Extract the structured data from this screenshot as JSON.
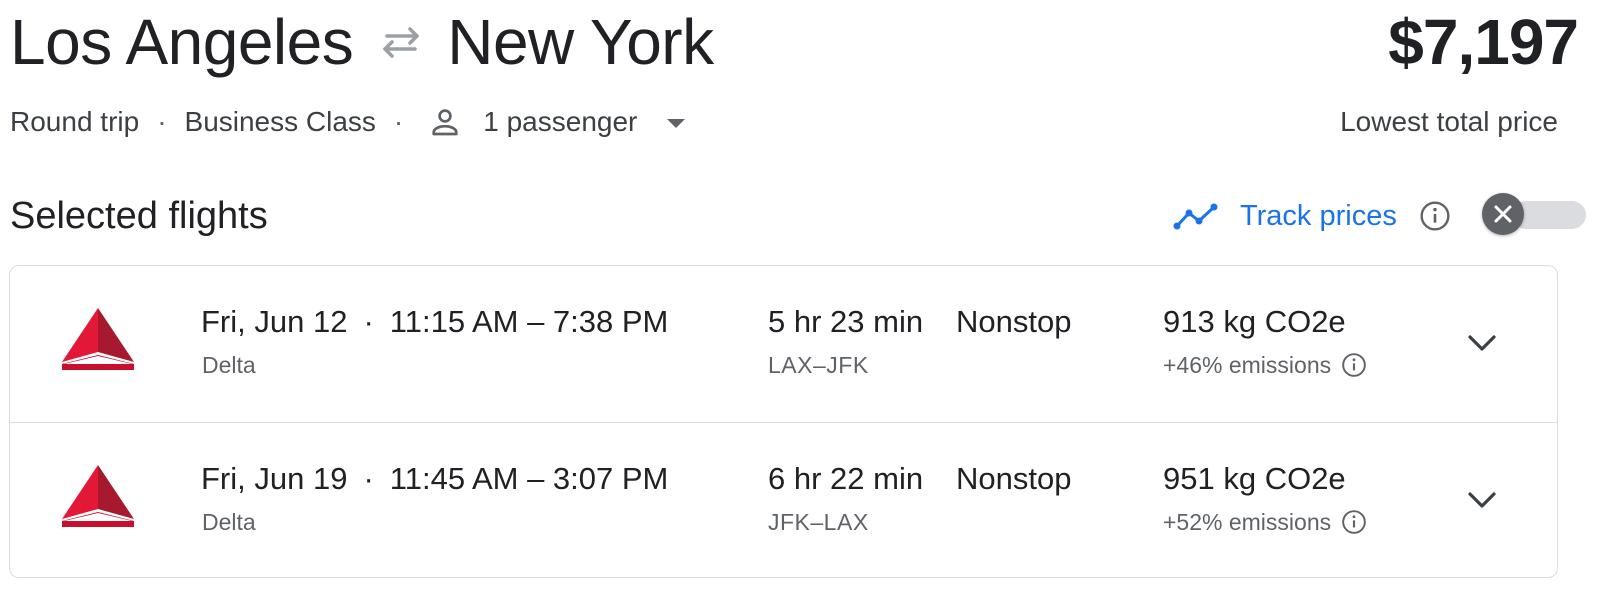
{
  "header": {
    "origin": "Los Angeles",
    "destination": "New York",
    "swap_icon": "swap-arrows-icon",
    "price": "$7,197",
    "price_caption": "Lowest total price"
  },
  "trip_options": {
    "trip_type": "Round trip",
    "separator": "·",
    "cabin_class": "Business Class",
    "passengers": "1 passenger",
    "passenger_icon": "person-icon",
    "dropdown_icon": "dropdown-caret-icon"
  },
  "section": {
    "title": "Selected flights",
    "track_prices_label": "Track prices",
    "track_icon": "trend-line-icon",
    "info_icon": "info-icon",
    "toggle_state": "off"
  },
  "flights": [
    {
      "date": "Fri, Jun 12",
      "separator": "·",
      "times": "11:15 AM – 7:38 PM",
      "airline": "Delta",
      "duration": "5 hr 23 min",
      "route": "LAX–JFK",
      "stops": "Nonstop",
      "co2": "913 kg CO2e",
      "emissions": "+46% emissions"
    },
    {
      "date": "Fri, Jun 19",
      "separator": "·",
      "times": "11:45 AM – 3:07 PM",
      "airline": "Delta",
      "duration": "6 hr 22 min",
      "route": "JFK–LAX",
      "stops": "Nonstop",
      "co2": "951 kg CO2e",
      "emissions": "+52% emissions"
    }
  ],
  "colors": {
    "accent": "#1a73e8",
    "text": "#202124",
    "secondary": "#5f6368",
    "delta_red": "#c8102e"
  }
}
